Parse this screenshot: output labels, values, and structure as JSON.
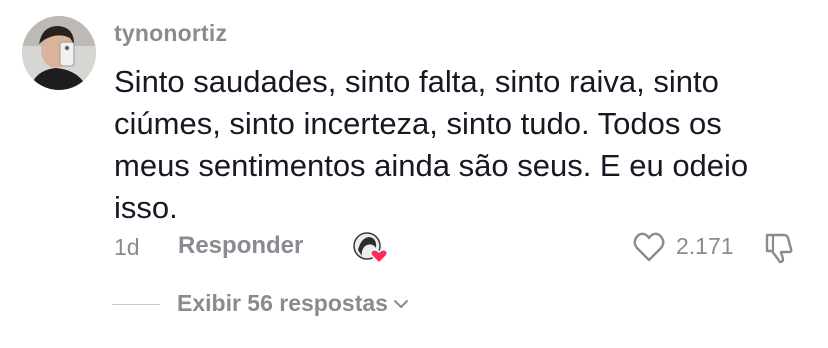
{
  "comment": {
    "username": "tynonortiz",
    "text": "Sinto saudades, sinto falta, sinto raiva, sinto ciúmes, sinto incerteza, sinto tudo. Todos os meus sentimentos ainda são seus. E eu odeio isso.",
    "time": "1d",
    "reply_label": "Responder",
    "like_count": "2.171",
    "view_replies_label": "Exibir 56 respostas"
  },
  "icons": {
    "avatar": "avatar-photo",
    "creator_like": "creator-liked-heart-icon",
    "like": "heart-outline-icon",
    "dislike": "thumbs-down-icon",
    "expand": "chevron-down-icon"
  },
  "colors": {
    "text": "#161823",
    "muted": "#8a8b91",
    "heart": "#fe2c55"
  }
}
